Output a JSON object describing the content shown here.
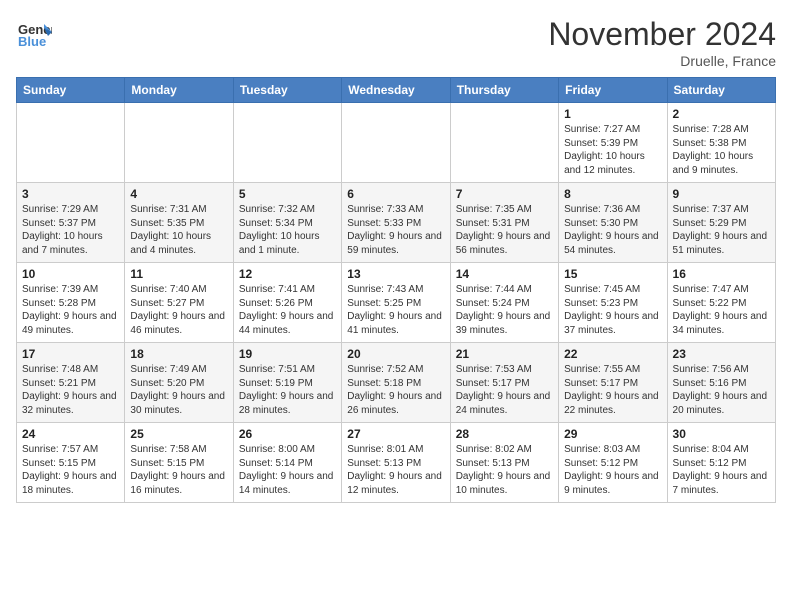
{
  "header": {
    "logo_line1": "General",
    "logo_line2": "Blue",
    "month": "November 2024",
    "location": "Druelle, France"
  },
  "weekdays": [
    "Sunday",
    "Monday",
    "Tuesday",
    "Wednesday",
    "Thursday",
    "Friday",
    "Saturday"
  ],
  "weeks": [
    [
      null,
      null,
      null,
      null,
      null,
      {
        "day": 1,
        "sunrise": "7:27 AM",
        "sunset": "5:39 PM",
        "daylight": "10 hours and 12 minutes."
      },
      {
        "day": 2,
        "sunrise": "7:28 AM",
        "sunset": "5:38 PM",
        "daylight": "10 hours and 9 minutes."
      }
    ],
    [
      {
        "day": 3,
        "sunrise": "7:29 AM",
        "sunset": "5:37 PM",
        "daylight": "10 hours and 7 minutes."
      },
      {
        "day": 4,
        "sunrise": "7:31 AM",
        "sunset": "5:35 PM",
        "daylight": "10 hours and 4 minutes."
      },
      {
        "day": 5,
        "sunrise": "7:32 AM",
        "sunset": "5:34 PM",
        "daylight": "10 hours and 1 minute."
      },
      {
        "day": 6,
        "sunrise": "7:33 AM",
        "sunset": "5:33 PM",
        "daylight": "9 hours and 59 minutes."
      },
      {
        "day": 7,
        "sunrise": "7:35 AM",
        "sunset": "5:31 PM",
        "daylight": "9 hours and 56 minutes."
      },
      {
        "day": 8,
        "sunrise": "7:36 AM",
        "sunset": "5:30 PM",
        "daylight": "9 hours and 54 minutes."
      },
      {
        "day": 9,
        "sunrise": "7:37 AM",
        "sunset": "5:29 PM",
        "daylight": "9 hours and 51 minutes."
      }
    ],
    [
      {
        "day": 10,
        "sunrise": "7:39 AM",
        "sunset": "5:28 PM",
        "daylight": "9 hours and 49 minutes."
      },
      {
        "day": 11,
        "sunrise": "7:40 AM",
        "sunset": "5:27 PM",
        "daylight": "9 hours and 46 minutes."
      },
      {
        "day": 12,
        "sunrise": "7:41 AM",
        "sunset": "5:26 PM",
        "daylight": "9 hours and 44 minutes."
      },
      {
        "day": 13,
        "sunrise": "7:43 AM",
        "sunset": "5:25 PM",
        "daylight": "9 hours and 41 minutes."
      },
      {
        "day": 14,
        "sunrise": "7:44 AM",
        "sunset": "5:24 PM",
        "daylight": "9 hours and 39 minutes."
      },
      {
        "day": 15,
        "sunrise": "7:45 AM",
        "sunset": "5:23 PM",
        "daylight": "9 hours and 37 minutes."
      },
      {
        "day": 16,
        "sunrise": "7:47 AM",
        "sunset": "5:22 PM",
        "daylight": "9 hours and 34 minutes."
      }
    ],
    [
      {
        "day": 17,
        "sunrise": "7:48 AM",
        "sunset": "5:21 PM",
        "daylight": "9 hours and 32 minutes."
      },
      {
        "day": 18,
        "sunrise": "7:49 AM",
        "sunset": "5:20 PM",
        "daylight": "9 hours and 30 minutes."
      },
      {
        "day": 19,
        "sunrise": "7:51 AM",
        "sunset": "5:19 PM",
        "daylight": "9 hours and 28 minutes."
      },
      {
        "day": 20,
        "sunrise": "7:52 AM",
        "sunset": "5:18 PM",
        "daylight": "9 hours and 26 minutes."
      },
      {
        "day": 21,
        "sunrise": "7:53 AM",
        "sunset": "5:17 PM",
        "daylight": "9 hours and 24 minutes."
      },
      {
        "day": 22,
        "sunrise": "7:55 AM",
        "sunset": "5:17 PM",
        "daylight": "9 hours and 22 minutes."
      },
      {
        "day": 23,
        "sunrise": "7:56 AM",
        "sunset": "5:16 PM",
        "daylight": "9 hours and 20 minutes."
      }
    ],
    [
      {
        "day": 24,
        "sunrise": "7:57 AM",
        "sunset": "5:15 PM",
        "daylight": "9 hours and 18 minutes."
      },
      {
        "day": 25,
        "sunrise": "7:58 AM",
        "sunset": "5:15 PM",
        "daylight": "9 hours and 16 minutes."
      },
      {
        "day": 26,
        "sunrise": "8:00 AM",
        "sunset": "5:14 PM",
        "daylight": "9 hours and 14 minutes."
      },
      {
        "day": 27,
        "sunrise": "8:01 AM",
        "sunset": "5:13 PM",
        "daylight": "9 hours and 12 minutes."
      },
      {
        "day": 28,
        "sunrise": "8:02 AM",
        "sunset": "5:13 PM",
        "daylight": "9 hours and 10 minutes."
      },
      {
        "day": 29,
        "sunrise": "8:03 AM",
        "sunset": "5:12 PM",
        "daylight": "9 hours and 9 minutes."
      },
      {
        "day": 30,
        "sunrise": "8:04 AM",
        "sunset": "5:12 PM",
        "daylight": "9 hours and 7 minutes."
      }
    ]
  ]
}
